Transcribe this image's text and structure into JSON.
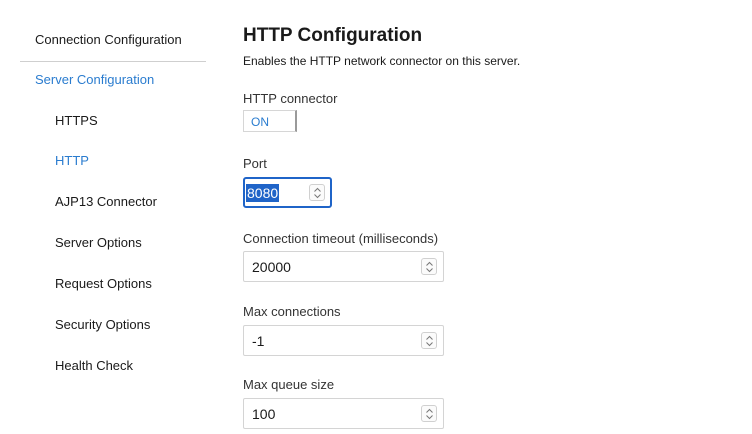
{
  "sidebar": {
    "top_label": "Connection Configuration",
    "section_label": "Server Configuration",
    "items": [
      {
        "label": "HTTPS",
        "active": false
      },
      {
        "label": "HTTP",
        "active": true
      },
      {
        "label": "AJP13 Connector",
        "active": false
      },
      {
        "label": "Server Options",
        "active": false
      },
      {
        "label": "Request Options",
        "active": false
      },
      {
        "label": "Security Options",
        "active": false
      },
      {
        "label": "Health Check",
        "active": false
      }
    ]
  },
  "main": {
    "title": "HTTP Configuration",
    "description": "Enables the HTTP network connector on this server.",
    "http_connector": {
      "label": "HTTP connector",
      "value": "ON"
    },
    "port": {
      "label": "Port",
      "value": "8080"
    },
    "connection_timeout": {
      "label": "Connection timeout (milliseconds)",
      "value": "20000"
    },
    "max_connections": {
      "label": "Max connections",
      "value": "-1"
    },
    "max_queue_size": {
      "label": "Max queue size",
      "value": "100"
    }
  },
  "colors": {
    "accent": "#2a7ccf",
    "focus": "#1f64c8"
  },
  "icons": {
    "stepper": "up-down-chevron-icon"
  }
}
